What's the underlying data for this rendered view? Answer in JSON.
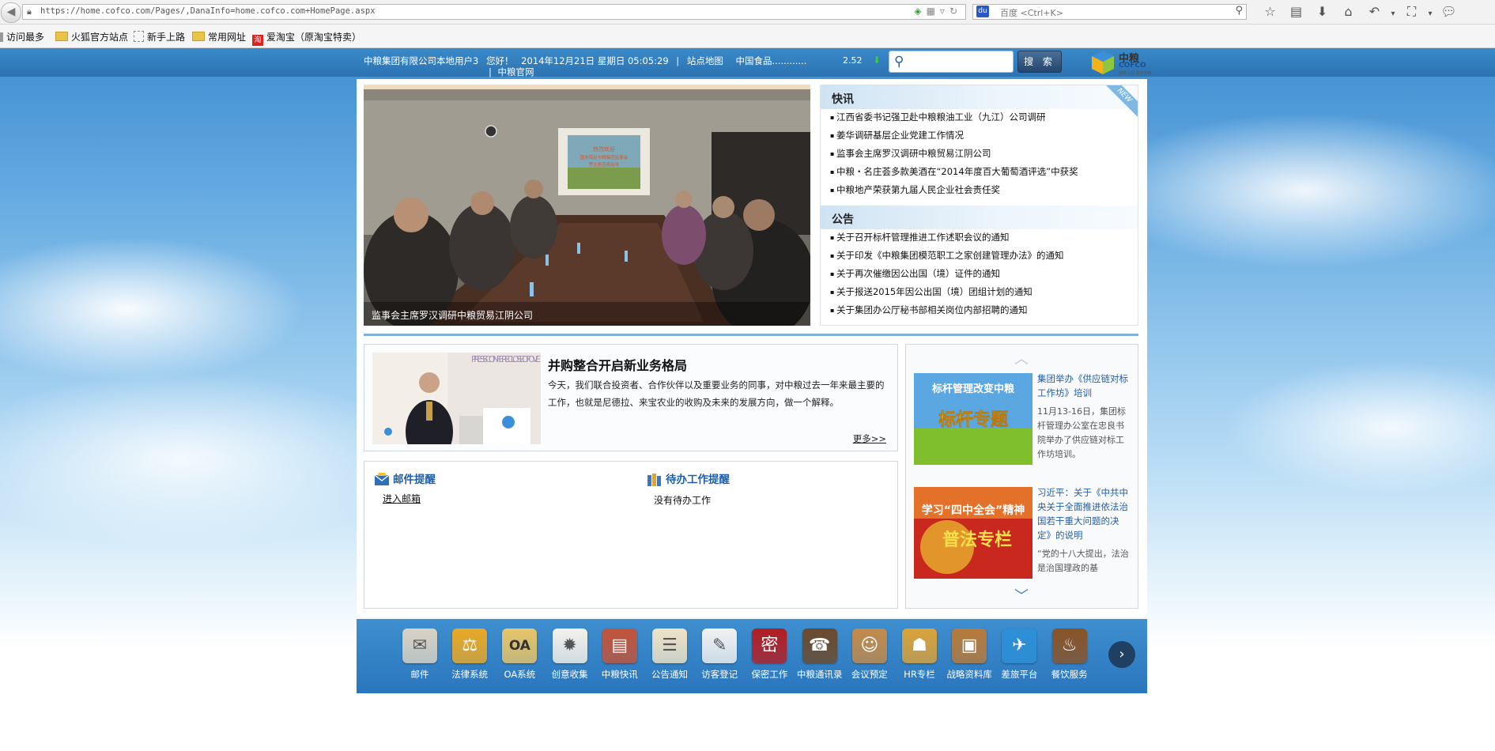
{
  "browser": {
    "url": "https://home.cofco.com/Pages/,DanaInfo=home.cofco.com+HomePage.aspx",
    "search_placeholder": "百度 <Ctrl+K>",
    "bookmarks": [
      {
        "label": "访问最多",
        "type": "folder"
      },
      {
        "label": "火狐官方站点",
        "type": "folder"
      },
      {
        "label": "新手上路",
        "type": "page"
      },
      {
        "label": "常用网址",
        "type": "folder"
      },
      {
        "label": "爱淘宝（原淘宝特卖）",
        "type": "red"
      }
    ]
  },
  "header": {
    "user": "中粮集团有限公司本地用户3",
    "greeting": "您好！",
    "datetime": "2014年12月21日 星期日 05:05:29",
    "site_map": "站点地图",
    "official_site": "中粮官网",
    "stock_name": "中国食品............",
    "stock_value": "2.52",
    "search_button": "搜 索",
    "logo_cn": "中粮",
    "logo_en": "COFCO",
    "logo_sub": "自然之源 重塑你我"
  },
  "slideshow": {
    "caption": "监事会主席罗汉调研中粮贸易江阴公司",
    "screen_text": [
      "热烈欢迎",
      "国务院驻中粮集团监事会",
      "罗主席莅临指导"
    ],
    "dots": 5,
    "active_dot": 0
  },
  "news": {
    "flash_title": "快讯",
    "new_badge": "NEW",
    "flash_items": [
      "江西省委书记强卫赴中粮粮油工业（九江）公司调研",
      "姜华调研基层企业党建工作情况",
      "监事会主席罗汉调研中粮贸易江阴公司",
      "中粮・名庄荟多款美酒在“2014年度百大葡萄酒评选”中获奖",
      "中粮地产荣获第九届人民企业社会责任奖"
    ],
    "notice_title": "公告",
    "notice_items": [
      "关于召开标杆管理推进工作述职会议的通知",
      "关于印发《中粮集团模范职工之家创建管理办法》的通知",
      "关于再次催缴因公出国（境）证件的通知",
      "关于报送2015年因公出国（境）团组计划的通知",
      "关于集团办公厅秘书部相关岗位内部招聘的通知"
    ]
  },
  "feature": {
    "title": "并购整合开启新业务格局",
    "text": "今天，我们联合投资者、合作伙伴以及重要业务的同事，对中粮过去一年来最主要的工作，也就是尼德拉、来宝农业的收购及未来的发展方向，做一个解释。",
    "more": "更多>>",
    "photo_banner": "PRESS CONFERE CLOSE OF OVE"
  },
  "reminders": {
    "mail_title": "邮件提醒",
    "mail_link": "进入邮箱",
    "todo_title": "待办工作提醒",
    "todo_text": "没有待办工作"
  },
  "side": {
    "items": [
      {
        "image_line1": "标杆管理改变中粮",
        "image_line2": "标杆专题",
        "title": "集团举办《供应链对标工作坊》培训",
        "desc": "11月13-16日，集团标杆管理办公室在忠良书院举办了供应链对标工作坊培训。"
      },
      {
        "image_line1": "学习“四中全会”精神",
        "image_line2": "普法专栏",
        "title": "习近平：关于《中共中央关于全面推进依法治国若干重大问题的决定》的说明",
        "desc": "“党的十八大提出，法治是治国理政的基"
      }
    ]
  },
  "apps": [
    {
      "label": "邮件",
      "icon": "mail-icon",
      "glyph": "✉",
      "color": "#d9d2c4"
    },
    {
      "label": "法律系统",
      "icon": "scales-icon",
      "glyph": "⚖",
      "color": "#e9a825"
    },
    {
      "label": "OA系统",
      "icon": "oa-icon",
      "glyph": "OA",
      "color": "#e6c46a"
    },
    {
      "label": "创意收集",
      "icon": "lightbulb-icon",
      "glyph": "✹",
      "color": "#f4f1ea"
    },
    {
      "label": "中粮快讯",
      "icon": "newspaper-icon",
      "glyph": "▤",
      "color": "#c0543b"
    },
    {
      "label": "公告通知",
      "icon": "notepad-icon",
      "glyph": "☰",
      "color": "#efe3c8"
    },
    {
      "label": "访客登记",
      "icon": "visitor-icon",
      "glyph": "✎",
      "color": "#f1f1f1"
    },
    {
      "label": "保密工作",
      "icon": "seal-icon",
      "glyph": "密",
      "color": "#b21e24"
    },
    {
      "label": "中粮通讯录",
      "icon": "addressbook-icon",
      "glyph": "☎",
      "color": "#6b4a2c"
    },
    {
      "label": "会议预定",
      "icon": "meeting-icon",
      "glyph": "☺",
      "color": "#c28a4a"
    },
    {
      "label": "HR专栏",
      "icon": "hr-icon",
      "glyph": "☗",
      "color": "#d9a23a"
    },
    {
      "label": "战略资料库",
      "icon": "briefcase-icon",
      "glyph": "▣",
      "color": "#b77a3a"
    },
    {
      "label": "差旅平台",
      "icon": "airplane-icon",
      "glyph": "✈",
      "color": "#2d8fd6"
    },
    {
      "label": "餐饮服务",
      "icon": "restaurant-icon",
      "glyph": "♨",
      "color": "#8a5327"
    }
  ]
}
